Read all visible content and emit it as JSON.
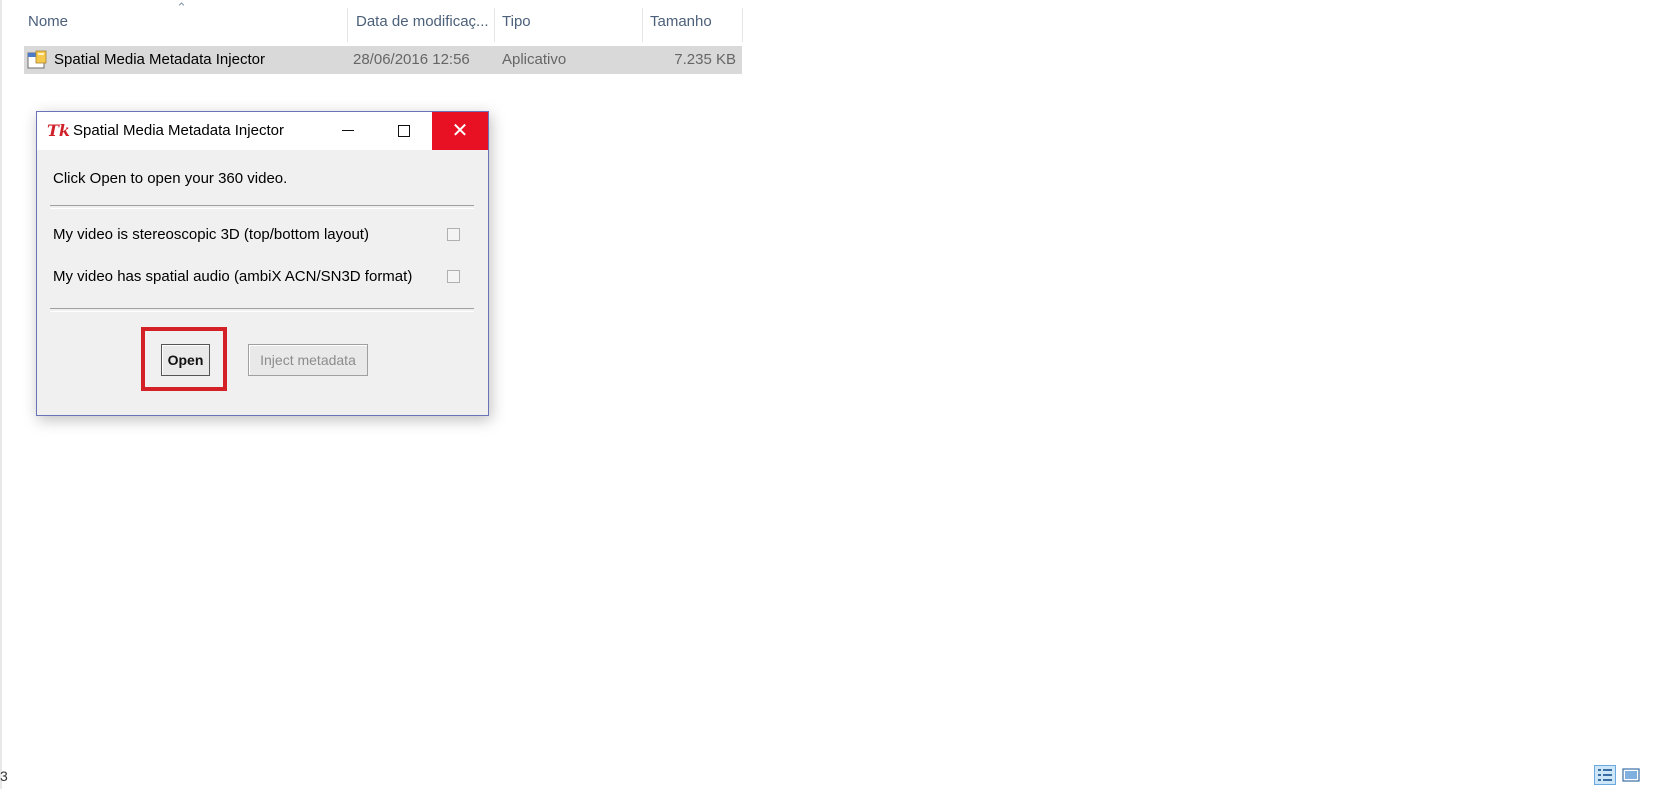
{
  "columns": {
    "name": "Nome",
    "date": "Data de modificaç...",
    "type": "Tipo",
    "size": "Tamanho"
  },
  "file": {
    "name": "Spatial Media Metadata Injector",
    "date": "28/06/2016 12:56",
    "type": "Aplicativo",
    "size": "7.235 KB",
    "icon": "application-icon"
  },
  "dialog": {
    "title": "Spatial Media Metadata Injector",
    "title_icon": "Tk",
    "prompt": "Click Open to open your 360 video.",
    "options": [
      {
        "label": "My video is stereoscopic 3D (top/bottom layout)",
        "checked": false
      },
      {
        "label": "My video has spatial audio (ambiX ACN/SN3D format)",
        "checked": false
      }
    ],
    "open_label": "Open",
    "inject_label": "Inject metadata",
    "inject_enabled": false,
    "highlight_color": "#d42027"
  },
  "status": {
    "corner_text": "3"
  },
  "colors": {
    "close_button": "#e81123",
    "selection": "#d9d9d9",
    "header_text": "#4c607a"
  }
}
